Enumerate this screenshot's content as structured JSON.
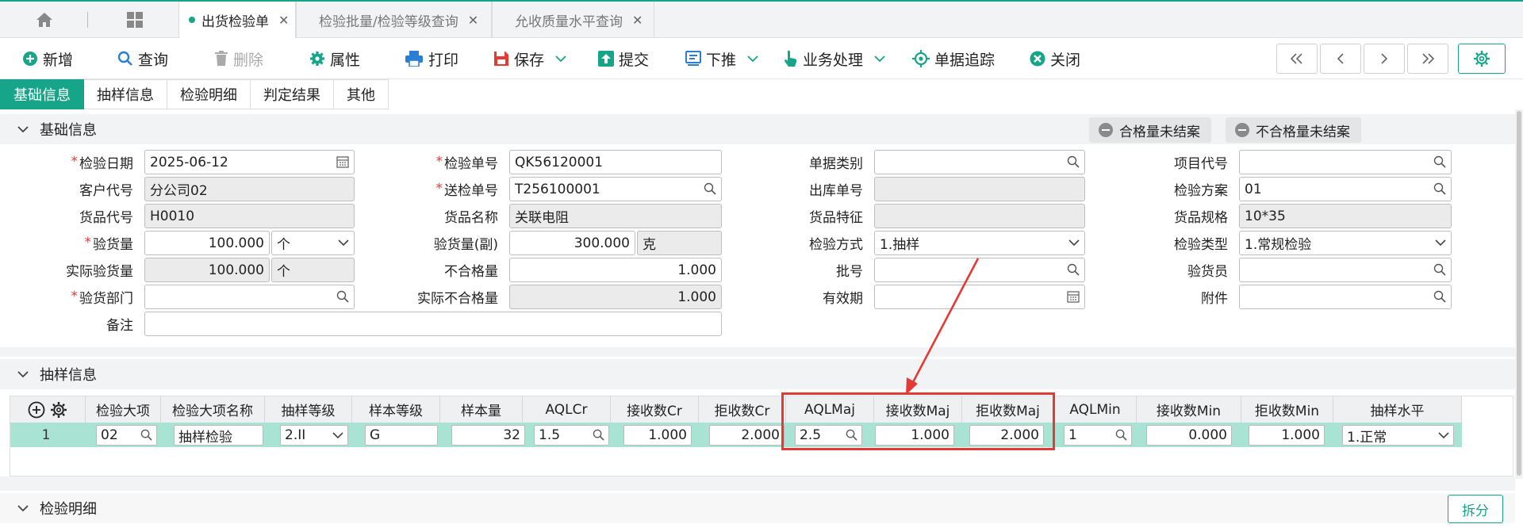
{
  "tabs": [
    {
      "label": "出货检验单",
      "active": true
    },
    {
      "label": "检验批量/检验等级查询",
      "active": false
    },
    {
      "label": "允收质量水平查询",
      "active": false
    }
  ],
  "toolbar": {
    "new": "新增",
    "query": "查询",
    "delete": "删除",
    "properties": "属性",
    "print": "打印",
    "save": "保存",
    "submit": "提交",
    "push_down": "下推",
    "business": "业务处理",
    "trace": "单据追踪",
    "close": "关闭"
  },
  "subtabs": [
    "基础信息",
    "抽样信息",
    "检验明细",
    "判定结果",
    "其他"
  ],
  "sections": {
    "basic": "基础信息",
    "sampling": "抽样信息",
    "detail": "检验明细"
  },
  "buttons": {
    "qualified_open": "合格量未结案",
    "unqualified_open": "不合格量未结案",
    "split": "拆分"
  },
  "form": {
    "inspect_date": {
      "label": "检验日期",
      "value": "2025-06-12"
    },
    "customer_code": {
      "label": "客户代号",
      "value": "分公司02"
    },
    "goods_code": {
      "label": "货品代号",
      "value": "H0010"
    },
    "inspect_qty": {
      "label": "验货量",
      "value": "100.000",
      "unit": "个"
    },
    "actual_qty": {
      "label": "实际验货量",
      "value": "100.000",
      "unit": "个"
    },
    "inspect_dept": {
      "label": "验货部门",
      "value": ""
    },
    "remark": {
      "label": "备注",
      "value": ""
    },
    "inspect_no": {
      "label": "检验单号",
      "value": "QK56120001"
    },
    "send_no": {
      "label": "送检单号",
      "value": "T256100001"
    },
    "goods_name": {
      "label": "货品名称",
      "value": "关联电阻"
    },
    "inspect_qty2": {
      "label": "验货量(副)",
      "value": "300.000",
      "unit": "克"
    },
    "unqualified": {
      "label": "不合格量",
      "value": "1.000"
    },
    "actual_unqualified": {
      "label": "实际不合格量",
      "value": "1.000"
    },
    "doc_type": {
      "label": "单据类别",
      "value": ""
    },
    "out_no": {
      "label": "出库单号",
      "value": ""
    },
    "goods_feature": {
      "label": "货品特征",
      "value": ""
    },
    "inspect_method": {
      "label": "检验方式",
      "value": "1.抽样"
    },
    "batch_no": {
      "label": "批号",
      "value": ""
    },
    "expiry": {
      "label": "有效期",
      "value": ""
    },
    "project_code": {
      "label": "项目代号",
      "value": ""
    },
    "inspect_plan": {
      "label": "检验方案",
      "value": "01"
    },
    "goods_spec": {
      "label": "货品规格",
      "value": "10*35"
    },
    "inspect_type": {
      "label": "检验类型",
      "value": "1.常规检验"
    },
    "inspector": {
      "label": "验货员",
      "value": ""
    },
    "attachment": {
      "label": "附件",
      "value": ""
    }
  },
  "sampling_table": {
    "columns": [
      "检验大项",
      "检验大项名称",
      "抽样等级",
      "样本等级",
      "样本量",
      "AQLCr",
      "接收数Cr",
      "拒收数Cr",
      "AQLMaj",
      "接收数Maj",
      "拒收数Maj",
      "AQLMin",
      "接收数Min",
      "拒收数Min",
      "抽样水平"
    ],
    "row": {
      "index": "1",
      "item": "02",
      "item_name": "抽样检验",
      "sample_grade": "2.II",
      "sample_level": "G",
      "sample_size": "32",
      "aql_cr": "1.5",
      "accept_cr": "1.000",
      "reject_cr": "2.000",
      "aql_maj": "2.5",
      "accept_maj": "1.000",
      "reject_maj": "2.000",
      "aql_min": "1",
      "accept_min": "0.000",
      "reject_min": "1.000",
      "sampling_level": "1.正常"
    }
  },
  "colors": {
    "accent": "#17a589",
    "highlight": "#e53935",
    "row_selected": "#a9e3d4"
  }
}
